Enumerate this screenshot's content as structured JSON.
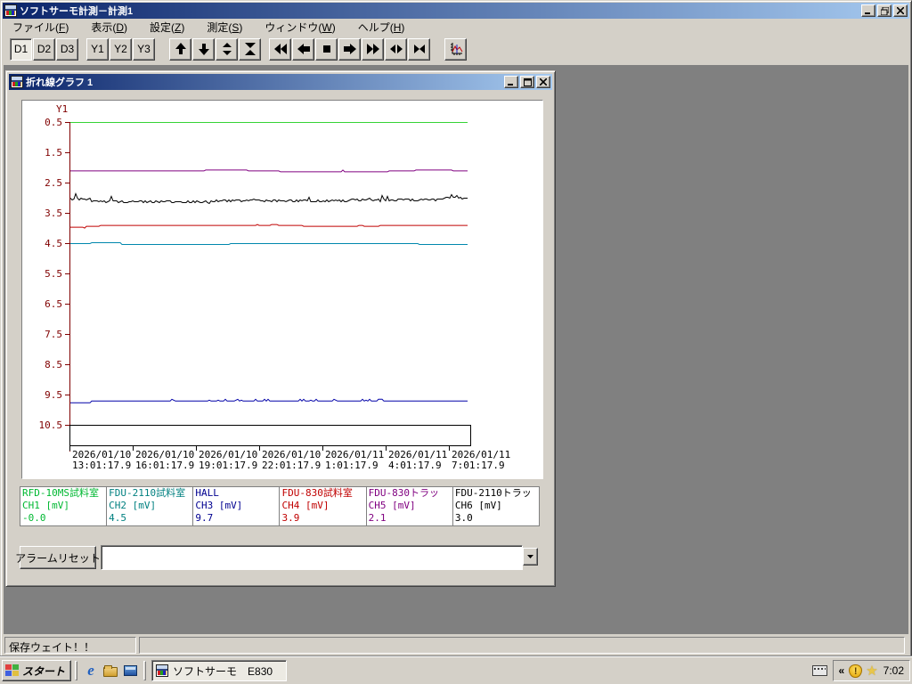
{
  "app": {
    "title": "ソフトサーモ計測－計測1",
    "menu": [
      "ファイル(F)",
      "表示(D)",
      "設定(Z)",
      "測定(S)",
      "ウィンドウ(W)",
      "ヘルプ(H)"
    ],
    "toolbar": {
      "d_buttons": [
        "D1",
        "D2",
        "D3"
      ],
      "y_buttons": [
        "Y1",
        "Y2",
        "Y3"
      ],
      "pressed_button": "D1",
      "icons": [
        "scroll-up",
        "scroll-down",
        "expand-vertical",
        "compress-vertical",
        "fast-rewind",
        "step-left",
        "stop",
        "step-right",
        "fast-forward",
        "expand-horizontal",
        "collapse-horizontal",
        "graph-settings"
      ]
    },
    "status_left": "保存ウェイト！！"
  },
  "graph_window": {
    "title": "折れ線グラフ 1",
    "alarm_reset_label": "アラームリセット",
    "combo_value": ""
  },
  "chart_data": {
    "type": "line",
    "y_axis_label": "Y1",
    "axis_color": "#800000",
    "ylim": [
      0.5,
      10.5
    ],
    "y_increases_downward": true,
    "y_ticks": [
      "0.5",
      "1.5",
      "2.5",
      "3.5",
      "4.5",
      "5.5",
      "6.5",
      "7.5",
      "8.5",
      "9.5",
      "10.5"
    ],
    "x_ticks": [
      {
        "date": "2026/01/10",
        "time": "13:01:17.9"
      },
      {
        "date": "2026/01/10",
        "time": "16:01:17.9"
      },
      {
        "date": "2026/01/10",
        "time": "19:01:17.9"
      },
      {
        "date": "2026/01/10",
        "time": "22:01:17.9"
      },
      {
        "date": "2026/01/11",
        "time": "1:01:17.9"
      },
      {
        "date": "2026/01/11",
        "time": "4:01:17.9"
      },
      {
        "date": "2026/01/11",
        "time": "7:01:17.9"
      }
    ],
    "series": [
      {
        "name": "RFD-10MS試料室",
        "channel": "CH1 [mV]",
        "value": "-0.0",
        "plot_value": -0.0,
        "color": "#00B832",
        "line_color": "#35D335",
        "noise": "none"
      },
      {
        "name": "FDU-2110試料室",
        "channel": "CH2 [mV]",
        "value": "4.5",
        "plot_value": 4.5,
        "color": "#008080",
        "line_color": "#0087AD",
        "noise": "tiny"
      },
      {
        "name": "HALL",
        "channel": "CH3 [mV]",
        "value": "9.7",
        "plot_value": 9.7,
        "color": "#000090",
        "line_color": "#0000A8",
        "noise": "navy"
      },
      {
        "name": "FDU-830試料室",
        "channel": "CH4 [mV]",
        "value": "3.9",
        "plot_value": 3.9,
        "color": "#C00000",
        "line_color": "#C00000",
        "noise": "red"
      },
      {
        "name": "FDU-830トラッ",
        "channel": "CH5 [mV]",
        "value": "2.1",
        "plot_value": 2.1,
        "color": "#800080",
        "line_color": "#800080",
        "noise": "tiny"
      },
      {
        "name": "FDU-2110トラッ",
        "channel": "CH6 [mV]",
        "value": "3.0",
        "plot_value": 3.0,
        "color": "#000000",
        "line_color": "#000000",
        "noise": "heavy"
      }
    ]
  },
  "taskbar": {
    "start_label": "スタート",
    "task_label": "ソフトサーモ　E830",
    "clock": "7:02"
  }
}
